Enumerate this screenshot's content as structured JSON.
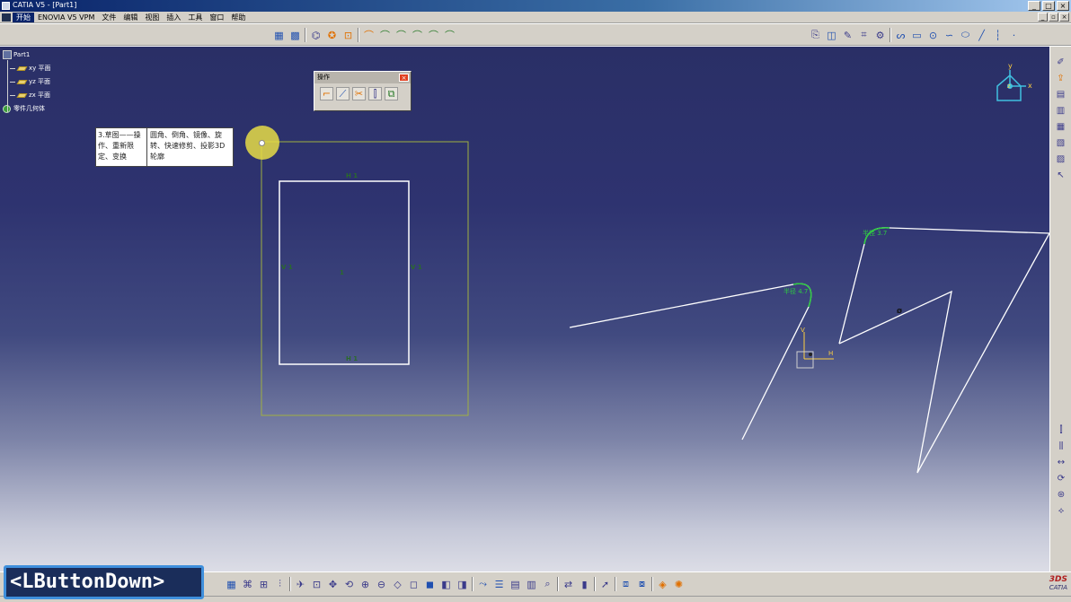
{
  "window": {
    "title": "CATIA V5 - [Part1]",
    "buttons": [
      "_",
      "□",
      "×"
    ]
  },
  "menu": {
    "items": [
      "开始",
      "ENOVIA V5 VPM",
      "文件",
      "编辑",
      "视图",
      "插入",
      "工具",
      "窗口",
      "帮助"
    ],
    "mdi_buttons": [
      "_",
      "▫",
      "×"
    ]
  },
  "tree": {
    "root": "Part1",
    "items": [
      {
        "label": "xy 平面",
        "icon": "plane-icon"
      },
      {
        "label": "yz 平面",
        "icon": "plane-icon"
      },
      {
        "label": "zx 平面",
        "icon": "plane-icon"
      },
      {
        "label": "零件几何体",
        "icon": "body-icon"
      }
    ]
  },
  "operation_toolbar": {
    "title": "操作",
    "icons": [
      "corner-icon",
      "chamfer-icon",
      "trim-icon",
      "mirror-icon",
      "project-3d-icon"
    ]
  },
  "note": {
    "col1": "3.草图——操作、重新限定、变换",
    "col2": "圆角、倒角、镜像、旋转、快速修剪、投影3D轮廓"
  },
  "sketch_labels": {
    "rect_top": "H 1",
    "rect_bottom": "H 1",
    "rect_left": "V 1",
    "rect_right": "V 1",
    "rect_center": "1",
    "constraint_right": "半径 3.7",
    "constraint_mid": "半径 4.7",
    "point_label": "Ø",
    "axis_h": "H",
    "axis_v": "V"
  },
  "compass": {
    "x_label": "x",
    "y_label": "y",
    "z_label": "z"
  },
  "logo": {
    "ds": "3DS",
    "name": "CATIA"
  },
  "event_overlay": "<LButtonDown>",
  "colors": {
    "sketch_line": "#ffffff",
    "constraint": "#2ecc40",
    "highlight": "#e6dc46",
    "viewport_top": "#2a2f66"
  }
}
